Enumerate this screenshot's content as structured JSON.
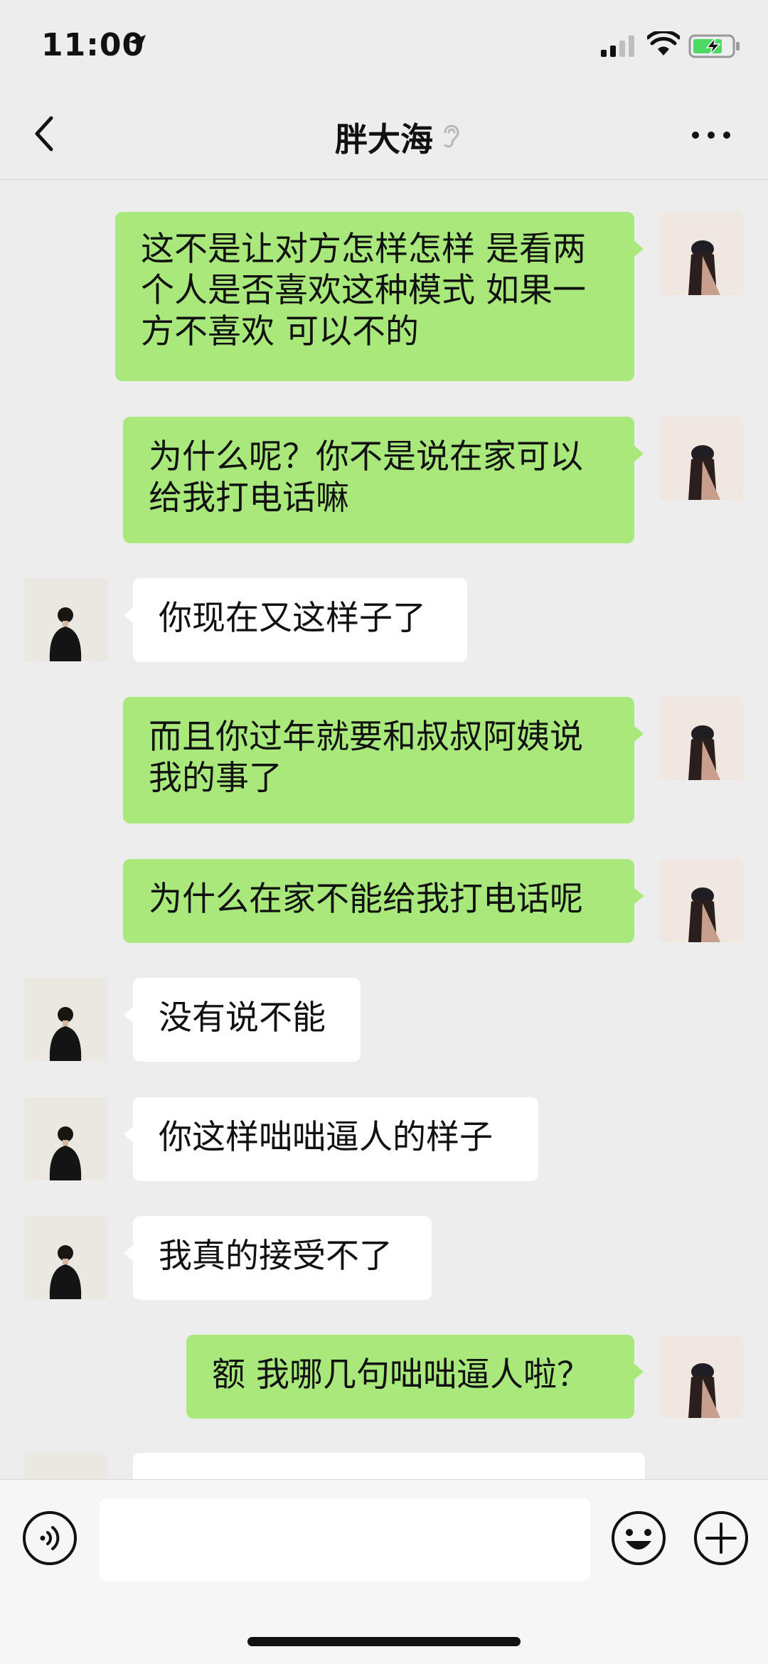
{
  "status": {
    "time": "11:00"
  },
  "nav": {
    "title": "胖大海"
  },
  "messages": [
    {
      "from": "me",
      "text": "这不是让对方怎样怎样 是看两个人是否喜欢这种模式 如果一方不喜欢 可以不的"
    },
    {
      "from": "me",
      "text": "为什么呢？你不是说在家可以给我打电话嘛"
    },
    {
      "from": "other",
      "text": "你现在又这样子了"
    },
    {
      "from": "me",
      "text": "而且你过年就要和叔叔阿姨说我的事了"
    },
    {
      "from": "me",
      "text": "为什么在家不能给我打电话呢"
    },
    {
      "from": "other",
      "text": "没有说不能"
    },
    {
      "from": "other",
      "text": "你这样咄咄逼人的样子"
    },
    {
      "from": "other",
      "text": "我真的接受不了"
    },
    {
      "from": "me",
      "text": "额 我哪几句咄咄逼人啦？"
    },
    {
      "from": "other",
      "text": ""
    }
  ],
  "input": {
    "value": ""
  },
  "colors": {
    "me_bubble": "#a9e97b",
    "other_bubble": "#ffffff",
    "background": "#ededed"
  }
}
